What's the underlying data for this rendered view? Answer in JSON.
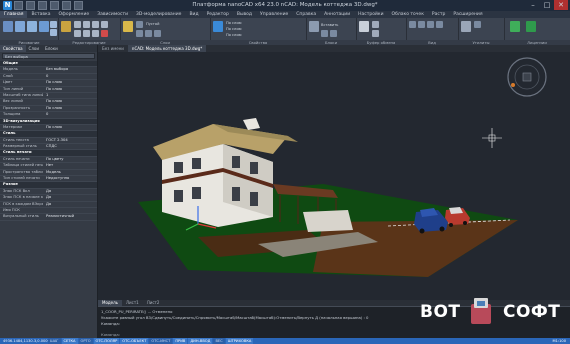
{
  "app": {
    "logo": "N",
    "title": "Платформа nanoCAD x64 23.0 nCAD: Модель коттеджа 3D.dwg*"
  },
  "window_controls": [
    "–",
    "□",
    "✕"
  ],
  "ribbon_tabs": [
    "Главная",
    "Вставка",
    "Оформление",
    "Зависимости",
    "3D-моделирование",
    "Вид",
    "Редактор",
    "Вывод",
    "Управление",
    "Справка",
    "Аннотации",
    "Настройки",
    "Облако точек",
    "Растр",
    "Расширения"
  ],
  "ribbon": {
    "groups": [
      "Рисование",
      "Редактирование",
      "Слои",
      "Свойства",
      "Блоки",
      "Буфер обмена",
      "Вид",
      "Утилиты",
      "Лицензии"
    ],
    "texts": {
      "layer_state": "Пустой",
      "linetype": "По слою",
      "lineweight": "По слою",
      "color": "По слою",
      "insert": "Вставить",
      "clipboard": "Буфер обмена"
    }
  },
  "panel": {
    "tabs": [
      "Свойства",
      "Слои",
      "Блоки"
    ],
    "filter": "Без выбора",
    "rows": [
      {
        "type": "section",
        "name": "Общие"
      },
      {
        "name": "Модель",
        "value": "Без выбора"
      },
      {
        "name": "Слой",
        "value": "0"
      },
      {
        "name": "Цвет",
        "value": "По слою"
      },
      {
        "name": "Тип линий",
        "value": "По слою"
      },
      {
        "name": "Масштаб типа линий",
        "value": "1"
      },
      {
        "name": "Вес линий",
        "value": "По слою"
      },
      {
        "name": "Прозрачность",
        "value": "По слою"
      },
      {
        "name": "Толщина",
        "value": "0"
      },
      {
        "type": "section",
        "name": "3D-визуализация"
      },
      {
        "name": "Материал",
        "value": "По слою"
      },
      {
        "type": "section",
        "name": "Стиль"
      },
      {
        "name": "Стиль текста",
        "value": "ГОСТ 2.304"
      },
      {
        "name": "Размерный стиль",
        "value": "СПДС"
      },
      {
        "type": "section",
        "name": "Стиль печати"
      },
      {
        "name": "Стиль печати",
        "value": "По цвету"
      },
      {
        "name": "Таблица стилей печати",
        "value": "Нет"
      },
      {
        "name": "Пространство таблицы стилей",
        "value": "Модель"
      },
      {
        "name": "Тип стилей печати",
        "value": "Недоступно"
      },
      {
        "type": "section",
        "name": "Разное"
      },
      {
        "name": "Знак ПСК Вкл",
        "value": "Да"
      },
      {
        "name": "Знак ПСК в начале коорд.",
        "value": "Да"
      },
      {
        "name": "ПСК в каждом ВЭкране",
        "value": "Да"
      },
      {
        "name": "Имя ПСК",
        "value": ""
      },
      {
        "name": "Визуальный стиль",
        "value": "Реалистичный"
      }
    ]
  },
  "doc_tabs": [
    "Без имени",
    "nCAD: Модель коттеджа 3D.dwg*"
  ],
  "layout_tabs": [
    "Модель",
    "Лист1",
    "Лист2"
  ],
  "command_lines": [
    "1_COOR_PU_PERIRATE() ... Отменено",
    "Укажите равный угол ВЗ/Сдвинуть/Соединить/Спрямить/Масштаб/Масштаб(Масштаб):Отменить/Вернуть Д (начальная вершина) : 0",
    "Команда:"
  ],
  "command_prompt": "Команда:",
  "status": {
    "coords": "4936.1484,1130.3,0.0000",
    "buttons": [
      {
        "label": "ШАГ",
        "on": false
      },
      {
        "label": "СЕТКА",
        "on": true
      },
      {
        "label": "ОРТО",
        "on": false
      },
      {
        "label": "ОТС-ПОЛЯР",
        "on": true
      },
      {
        "label": "ОТС-ОБЪЕКТ",
        "on": true
      },
      {
        "label": "ОТС-ИНСТ",
        "on": false
      },
      {
        "label": "ПРИВ",
        "on": true
      },
      {
        "label": "ДИН-ВВОД",
        "on": true
      },
      {
        "label": "ВЕС",
        "on": false
      },
      {
        "label": "ШТРИХОВКА",
        "on": true
      }
    ],
    "scale": "M1:100"
  },
  "watermark": {
    "left": "ВОТ",
    "right": "СОФТ"
  },
  "colors": {
    "accent": "#2a66b8",
    "ground": "#0f4a12",
    "roof": "#b8a169",
    "wall": "#e8e6e0"
  }
}
